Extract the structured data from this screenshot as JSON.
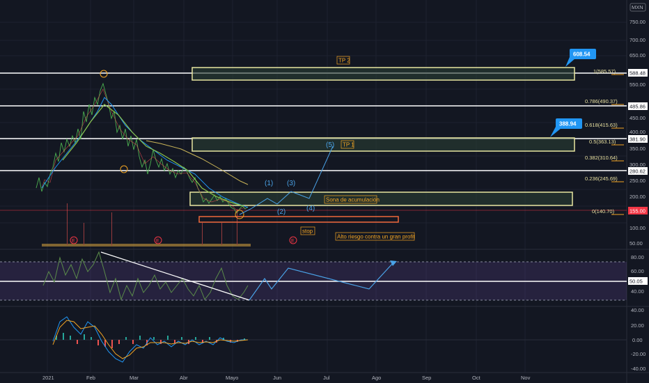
{
  "currency": "MXN",
  "price_axis": [
    "750.00",
    "700.00",
    "650.00",
    "600.00",
    "550.00",
    "500.00",
    "450.00",
    "400.00",
    "350.00",
    "300.00",
    "250.00",
    "200.00",
    "150.00",
    "100.00",
    "50.00"
  ],
  "price_axis_markers": [
    {
      "label": "588.48",
      "color": "#ffffff"
    },
    {
      "label": "485.86",
      "color": "#ffffff"
    },
    {
      "label": "381.90",
      "color": "#ffffff"
    },
    {
      "label": "280.62",
      "color": "#ffffff"
    },
    {
      "label": "155.00",
      "color": "#f23645"
    }
  ],
  "osc_axis": [
    "80.00",
    "60.00",
    "50.05",
    "40.00"
  ],
  "macd_axis": [
    "40.00",
    "20.00",
    "0.00",
    "-20.00",
    "-40.00"
  ],
  "time_axis": [
    "2021",
    "Feb",
    "Mar",
    "Abr",
    "Mayo",
    "Jun",
    "Jul",
    "Ago",
    "Sep",
    "Oct",
    "Nov"
  ],
  "fib_levels": [
    {
      "label": "1(585.57)"
    },
    {
      "label": "0.786(490.37)"
    },
    {
      "label": "0.618(415.63)"
    },
    {
      "label": "0.5(363.13)"
    },
    {
      "label": "0.382(310.64)"
    },
    {
      "label": "0.236(245.69)"
    },
    {
      "label": "0(140.70)"
    }
  ],
  "boxes": {
    "tp2_label": "TP 2",
    "tp1_label": "TP 1",
    "accum_label": "Sona de acumulación",
    "stop_label": "stop",
    "risk_label": "Alto riesgo contra un gran profit"
  },
  "targets": {
    "tp2_price": "608.54",
    "tp1_price": "388.94"
  },
  "waves": [
    "(1)",
    "(2)",
    "(3)",
    "(4)",
    "(5)"
  ],
  "events": [
    "E",
    "E",
    "E"
  ],
  "colors": {
    "bg": "#131722",
    "accent": "#2196f3",
    "box": "#e8e6a0",
    "stop": "#f23645",
    "fib": "#f5a623"
  }
}
